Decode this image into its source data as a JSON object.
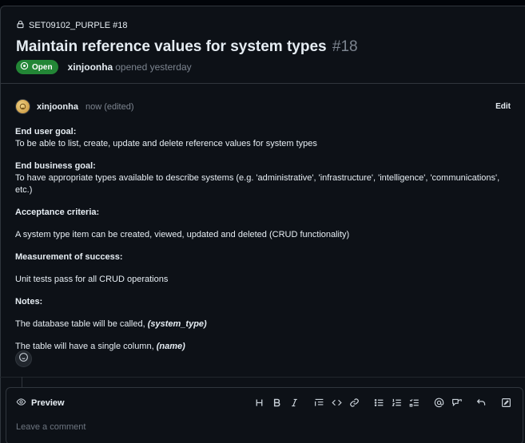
{
  "header": {
    "repo_ref": "SET09102_PURPLE #18",
    "title": "Maintain reference values for system types",
    "issue_number": "#18",
    "status": "Open",
    "author": "xinjoonha",
    "opened_text": "opened yesterday"
  },
  "comment": {
    "author": "xinjoonha",
    "time": "now (edited)",
    "edit_label": "Edit",
    "lines": {
      "goal_user_h": "End user goal:",
      "goal_user": "To be able to list, create, update and delete reference values for system types",
      "goal_biz_h": "End business goal:",
      "goal_biz": "To have appropriate types available to describe systems (e.g. 'administrative', 'infrastructure', 'intelligence', 'communications', etc.)",
      "criteria_h": "Acceptance criteria:",
      "criteria": "A system type item can be created, viewed, updated and deleted (CRUD functionality)",
      "success_h": "Measurement of success:",
      "success": "Unit tests pass for all CRUD operations",
      "notes_h": "Notes:",
      "note1_prefix": "The database table will be called, ",
      "note1_em": "(system_type)",
      "note2_prefix": "The table will have a single column, ",
      "note2_em": "(name)"
    }
  },
  "editor": {
    "tab_label": "Preview",
    "placeholder": "Leave a comment",
    "tools": [
      "heading-icon",
      "bold-icon",
      "italic-icon",
      "quote-icon",
      "code-icon",
      "link-icon",
      "unordered-list-icon",
      "ordered-list-icon",
      "task-list-icon",
      "mention-icon",
      "cross-reference-icon",
      "undo-icon",
      "fullscreen-icon"
    ]
  },
  "colors": {
    "background": "#0d1117",
    "open_badge": "#238636",
    "muted_text": "#7d8590",
    "border": "#30363d"
  }
}
